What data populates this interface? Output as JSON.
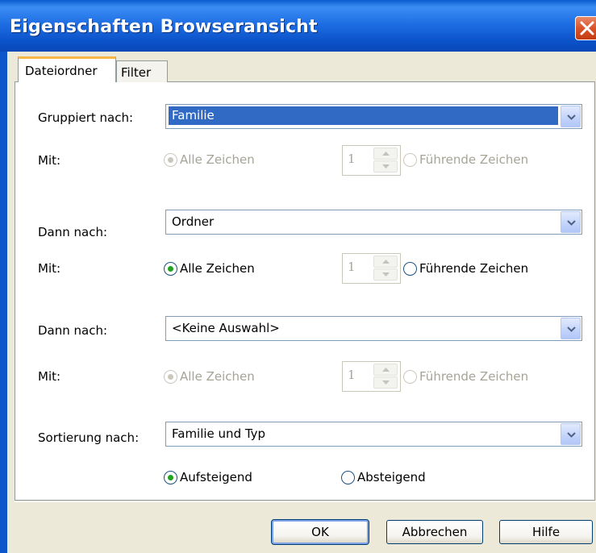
{
  "window": {
    "title": "Eigenschaften Browseransicht"
  },
  "tabs": [
    {
      "label": "Dateiordner",
      "active": true
    },
    {
      "label": "Filter",
      "active": false
    }
  ],
  "groups": [
    {
      "label": "Gruppiert nach:",
      "value": "Familie",
      "selected": true,
      "mit_label": "Mit:",
      "option_all": "Alle Zeichen",
      "option_leading": "Führende Zeichen",
      "count": "1",
      "enabled": false,
      "checked": "all"
    },
    {
      "label": "Dann nach:",
      "value": "Ordner",
      "selected": false,
      "mit_label": "Mit:",
      "option_all": "Alle Zeichen",
      "option_leading": "Führende Zeichen",
      "count": "1",
      "enabled": true,
      "checked": "all"
    },
    {
      "label": "Dann nach:",
      "value": "<Keine Auswahl>",
      "selected": false,
      "mit_label": "Mit:",
      "option_all": "Alle Zeichen",
      "option_leading": "Führende Zeichen",
      "count": "1",
      "enabled": false,
      "checked": "all"
    }
  ],
  "sort": {
    "label": "Sortierung nach:",
    "value": "Familie und Typ",
    "ascending": "Aufsteigend",
    "descending": "Absteigend",
    "checked": "ascending"
  },
  "buttons": {
    "ok": "OK",
    "cancel": "Abbrechen",
    "help": "Hilfe"
  },
  "colors": {
    "titlebar": "#0b52c9",
    "selection": "#316ac5",
    "radio_dot": "#23a31c",
    "disabled_text": "#a6a496",
    "close": "#d9532a"
  }
}
